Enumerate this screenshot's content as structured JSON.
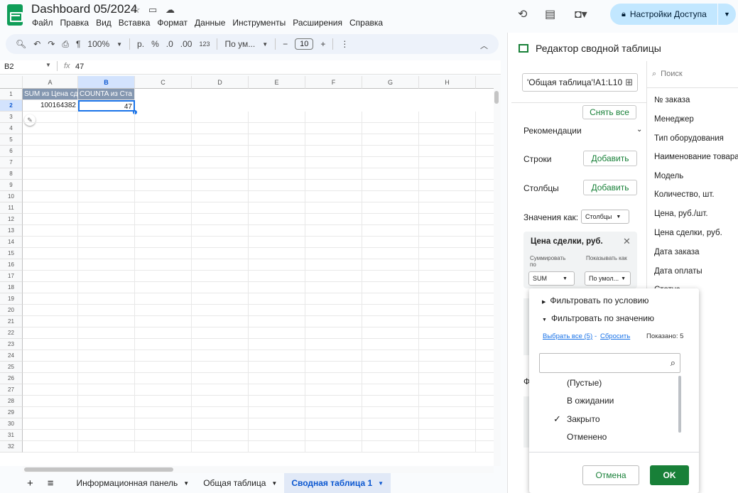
{
  "app": {
    "title": "Dashboard 05/2024",
    "menus": [
      "Файл",
      "Правка",
      "Вид",
      "Вставка",
      "Формат",
      "Данные",
      "Инструменты",
      "Расширения",
      "Справка"
    ],
    "share_label": "Настройки Доступа"
  },
  "toolbar": {
    "zoom": "100%",
    "currency": "р.",
    "percent": "%",
    "dec_less": ".0",
    "dec_more": ".00",
    "format123": "123",
    "font": "По ум...",
    "font_size": "10"
  },
  "formula": {
    "cell_ref": "B2",
    "fx": "fx",
    "value": "47"
  },
  "grid": {
    "columns": [
      "A",
      "B",
      "C",
      "D",
      "E",
      "F",
      "G",
      "H"
    ],
    "rows": [
      "1",
      "2",
      "3",
      "4",
      "5",
      "6",
      "7",
      "8",
      "9",
      "10",
      "11",
      "12",
      "13",
      "14",
      "15",
      "16",
      "17",
      "18",
      "19",
      "20",
      "21",
      "22",
      "23",
      "24",
      "25",
      "26",
      "27",
      "28",
      "29",
      "30",
      "31",
      "32"
    ],
    "a1": "SUM из Цена сд",
    "b1": "COUNTA из Ста",
    "a2": "100164382",
    "b2": "47"
  },
  "sheets": [
    "Информационная панель",
    "Общая таблица",
    "Сводная таблица 1"
  ],
  "panel": {
    "title": "Редактор сводной таблицы",
    "range": "'Общая таблица'!A1:L10",
    "clear_all": "Снять все",
    "recommendations": "Рекомендации",
    "rows": "Строки",
    "columns": "Столбцы",
    "add": "Добавить",
    "values_as": "Значения как:",
    "values_as_option": "Столбцы",
    "value_field": "Цена сделки, руб.",
    "summarize_by": "Суммировать по",
    "show_as": "Показывать как",
    "summarize_value": "SUM",
    "show_value": "По умол...",
    "partial_f": "Ф"
  },
  "fields": {
    "search_placeholder": "Поиск",
    "items": [
      "№ заказа",
      "Менеджер",
      "Тип оборудования",
      "Наименование товара",
      "Модель",
      "Количество, шт.",
      "Цена, руб./шт.",
      "Цена сделки, руб.",
      "Дата заказа",
      "Дата оплаты",
      "Статус"
    ]
  },
  "filter": {
    "by_condition": "Фильтровать по условию",
    "by_value": "Фильтровать по значению",
    "select_all": "Выбрать все (5)",
    "dash": " - ",
    "reset": "Сбросить",
    "shown": "Показано: 5",
    "options": [
      {
        "label": "(Пустые)",
        "checked": false
      },
      {
        "label": "В ожидании",
        "checked": false
      },
      {
        "label": "Закрыто",
        "checked": true
      },
      {
        "label": "Отменено",
        "checked": false
      }
    ],
    "cancel": "Отмена",
    "ok": "OK"
  }
}
